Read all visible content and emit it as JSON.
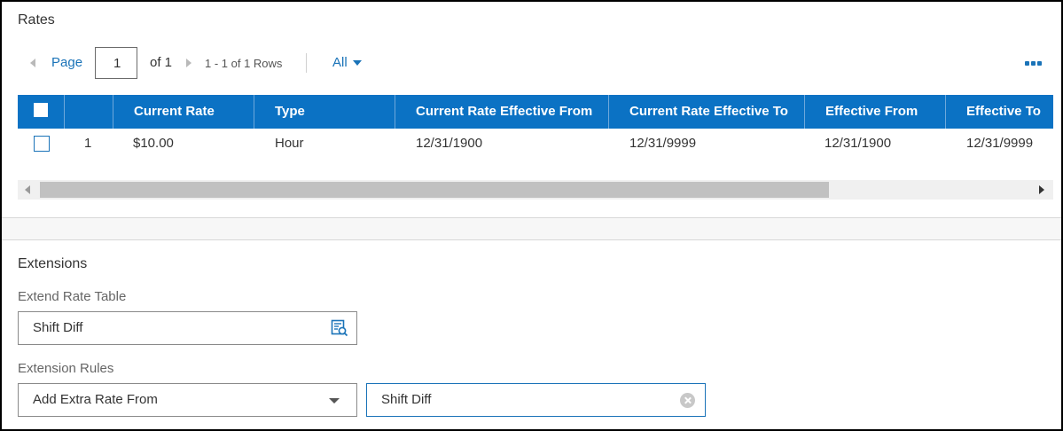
{
  "rates": {
    "title": "Rates",
    "pager": {
      "page_label": "Page",
      "page_value": "1",
      "of_text": "of 1",
      "rows_text": "1 - 1 of 1 Rows",
      "filter_label": "All"
    },
    "columns": [
      "Current Rate",
      "Type",
      "Current Rate Effective From",
      "Current Rate Effective To",
      "Effective From",
      "Effective To"
    ],
    "rows": [
      {
        "num": "1",
        "current_rate": "$10.00",
        "type": "Hour",
        "cr_eff_from": "12/31/1900",
        "cr_eff_to": "12/31/9999",
        "eff_from": "12/31/1900",
        "eff_to": "12/31/9999"
      }
    ]
  },
  "extensions": {
    "title": "Extensions",
    "extend_rate_table_label": "Extend Rate Table",
    "extend_rate_table_value": "Shift Diff",
    "extension_rules_label": "Extension Rules",
    "rule_select_value": "Add Extra Rate From",
    "rule_value": "Shift Diff"
  },
  "icons": {
    "lookup": "table-search-icon",
    "clear": "clear-circle-icon",
    "more": "more-horizontal-icon"
  },
  "colors": {
    "accent": "#1a73b8",
    "header_bg": "#0b72c4"
  }
}
